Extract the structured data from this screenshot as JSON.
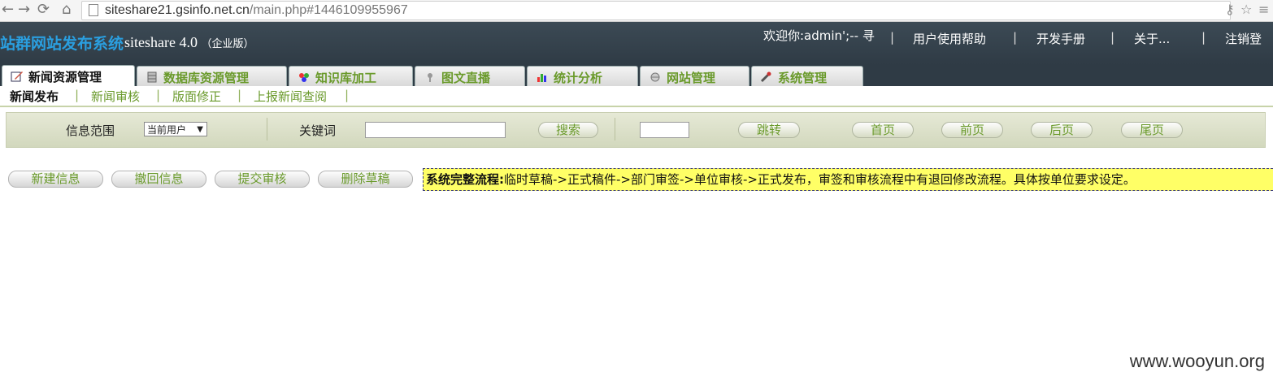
{
  "browser": {
    "url_host": "siteshare21.gsinfo.net.cn",
    "url_path": "/main.php#1446109955967"
  },
  "header": {
    "logo": "站群网站发布系统",
    "brand": "siteshare 4.0",
    "edition": "（企业版）",
    "welcome": "欢迎你:admin';--  寻",
    "links": [
      "用户使用帮助",
      "开发手册",
      "关于...",
      "注销登"
    ]
  },
  "tabs": [
    {
      "label": "新闻资源管理",
      "active": true,
      "icon": "edit-icon"
    },
    {
      "label": "数据库资源管理",
      "active": false,
      "icon": "database-icon"
    },
    {
      "label": "知识库加工",
      "active": false,
      "icon": "knowledge-icon"
    },
    {
      "label": "图文直播",
      "active": false,
      "icon": "broadcast-icon"
    },
    {
      "label": "统计分析",
      "active": false,
      "icon": "chart-icon"
    },
    {
      "label": "网站管理",
      "active": false,
      "icon": "globe-icon"
    },
    {
      "label": "系统管理",
      "active": false,
      "icon": "wrench-icon"
    }
  ],
  "subnav": [
    "新闻发布",
    "新闻审核",
    "版面修正",
    "上报新闻查阅"
  ],
  "search": {
    "scope_label": "信息范围",
    "scope_value": "当前用户",
    "keyword_label": "关键词",
    "keyword_value": "",
    "search_button": "搜索",
    "page_value": "",
    "jump_button": "跳转",
    "first_button": "首页",
    "prev_button": "前页",
    "next_button": "后页",
    "last_button": "尾页"
  },
  "actions": [
    "新建信息",
    "撤回信息",
    "提交审核",
    "删除草稿"
  ],
  "notice": {
    "title": "系统完整流程:",
    "text": "临时草稿->正式稿件->部门审签->单位审核->正式发布，审签和审核流程中有退回修改流程。具体按单位要求设定。"
  },
  "watermark": "www.wooyun.org",
  "colors": {
    "accent": "#6a9a2b",
    "header_bg": "#2f3b45",
    "notice_bg": "#ffff66"
  }
}
